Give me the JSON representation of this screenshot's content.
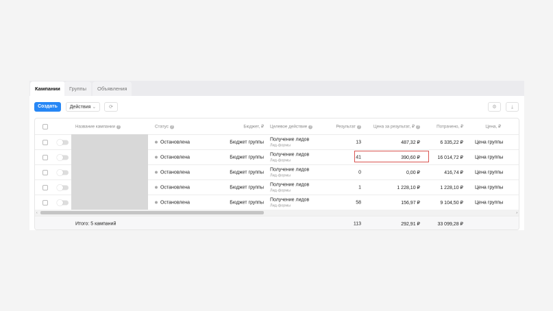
{
  "tabs": [
    "Кампании",
    "Группы",
    "Объявления"
  ],
  "toolbar": {
    "create": "Создать",
    "actions": "Действия"
  },
  "icons": {
    "refresh": "refresh-icon",
    "settings": "gear-icon",
    "download": "download-icon"
  },
  "headers": {
    "name": "Название кампании",
    "status": "Статус",
    "budget": "Бюджет, ₽",
    "target": "Целевое действие",
    "result": "Результат",
    "cpr": "Цена за результат, ₽",
    "spent": "Потрачено, ₽",
    "price": "Цена, ₽"
  },
  "rows": [
    {
      "status": "Остановлена",
      "budget": "Бюджет группы",
      "target": "Получение лидов",
      "target_sub": "Лид-формы",
      "result": "13",
      "cpr": "487,32 ₽",
      "spent": "6 335,22 ₽",
      "price": "Цена группы"
    },
    {
      "status": "Остановлена",
      "budget": "Бюджет группы",
      "target": "Получение лидов",
      "target_sub": "Лид-формы",
      "result": "41",
      "cpr": "390,60 ₽",
      "spent": "16 014,72 ₽",
      "price": "Цена группы"
    },
    {
      "status": "Остановлена",
      "budget": "Бюджет группы",
      "target": "Получение лидов",
      "target_sub": "Лид-формы",
      "result": "0",
      "cpr": "0,00 ₽",
      "spent": "416,74 ₽",
      "price": "Цена группы"
    },
    {
      "status": "Остановлена",
      "budget": "Бюджет группы",
      "target": "Получение лидов",
      "target_sub": "Лид-формы",
      "result": "1",
      "cpr": "1 228,10 ₽",
      "spent": "1 228,10 ₽",
      "price": "Цена группы"
    },
    {
      "status": "Остановлена",
      "budget": "Бюджет группы",
      "target": "Получение лидов",
      "target_sub": "Лид-формы",
      "result": "58",
      "cpr": "156,97 ₽",
      "spent": "9 104,50 ₽",
      "price": "Цена группы"
    }
  ],
  "footer": {
    "label": "Итого: 5 кампаний",
    "result": "113",
    "cpr": "292,91 ₽",
    "spent": "33 099,28 ₽"
  }
}
